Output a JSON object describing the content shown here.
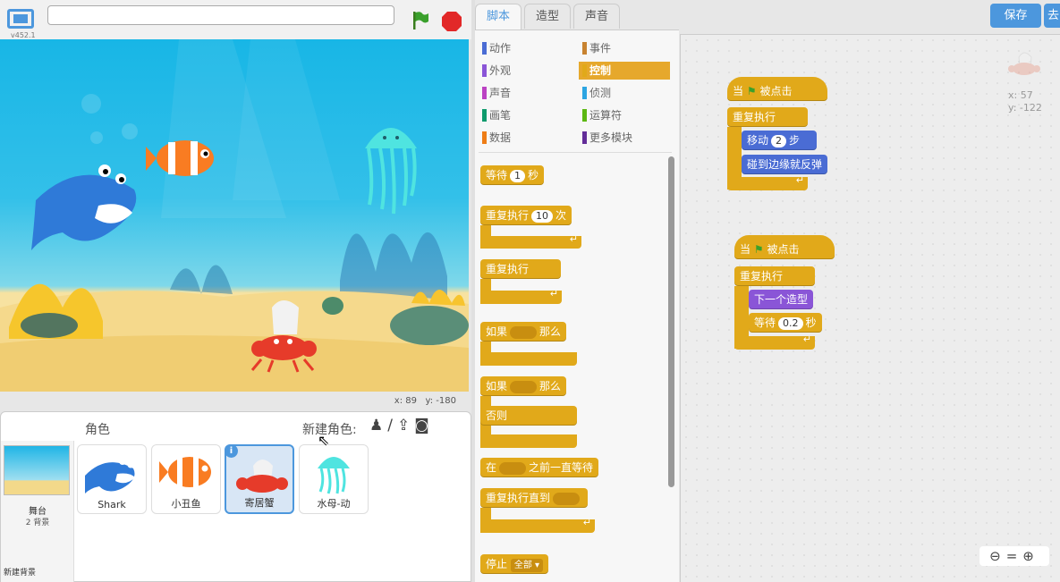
{
  "app": {
    "version": "v452.1",
    "project_title": ""
  },
  "stage": {
    "coord_x_label": "x:",
    "coord_x": "89",
    "coord_y_label": "y:",
    "coord_y": "-180"
  },
  "sprites_panel": {
    "label": "角色",
    "new_sprite_label": "新建角色:",
    "stage_label": "舞台",
    "stage_bg_count": "2 背景",
    "new_backdrop_label": "新建背景",
    "sprites": [
      {
        "name": "Shark"
      },
      {
        "name": "小丑鱼"
      },
      {
        "name": "寄居蟹",
        "selected": true
      },
      {
        "name": "水母-动"
      }
    ]
  },
  "tabs": [
    {
      "label": "脚本",
      "active": true
    },
    {
      "label": "造型"
    },
    {
      "label": "声音"
    }
  ],
  "toolbar": {
    "save_label": "保存",
    "share_label": "去"
  },
  "categories": [
    {
      "label": "动作",
      "color": "#4a6cd4"
    },
    {
      "label": "事件",
      "color": "#c88330"
    },
    {
      "label": "外观",
      "color": "#8a55d7"
    },
    {
      "label": "控制",
      "color": "#e1a91a",
      "selected": true
    },
    {
      "label": "声音",
      "color": "#bb42c3"
    },
    {
      "label": "侦测",
      "color": "#2ca5e2"
    },
    {
      "label": "画笔",
      "color": "#0e9a6c"
    },
    {
      "label": "运算符",
      "color": "#5cb712"
    },
    {
      "label": "数据",
      "color": "#ee7d16"
    },
    {
      "label": "更多模块",
      "color": "#632d99"
    }
  ],
  "palette_blocks": {
    "wait": {
      "pre": "等待",
      "val": "1",
      "post": "秒"
    },
    "repeat": {
      "pre": "重复执行",
      "val": "10",
      "post": "次"
    },
    "forever": {
      "label": "重复执行"
    },
    "if_then": {
      "pre": "如果",
      "post": "那么"
    },
    "if_else": {
      "pre": "如果",
      "post": "那么",
      "else": "否则"
    },
    "wait_until": {
      "pre": "在",
      "post": "之前一直等待"
    },
    "repeat_until": {
      "label": "重复执行直到"
    },
    "stop": {
      "label": "停止",
      "option": "全部"
    }
  },
  "script1": {
    "hat_pre": "当",
    "hat_post": "被点击",
    "forever": "重复执行",
    "move_pre": "移动",
    "move_val": "2",
    "move_post": "步",
    "bounce": "碰到边缘就反弹"
  },
  "script2": {
    "hat_pre": "当",
    "hat_post": "被点击",
    "forever": "重复执行",
    "next_costume": "下一个造型",
    "wait_pre": "等待",
    "wait_val": "0.2",
    "wait_post": "秒"
  },
  "sprite_info": {
    "x_label": "x:",
    "x": "57",
    "y_label": "y:",
    "y": "-122"
  }
}
